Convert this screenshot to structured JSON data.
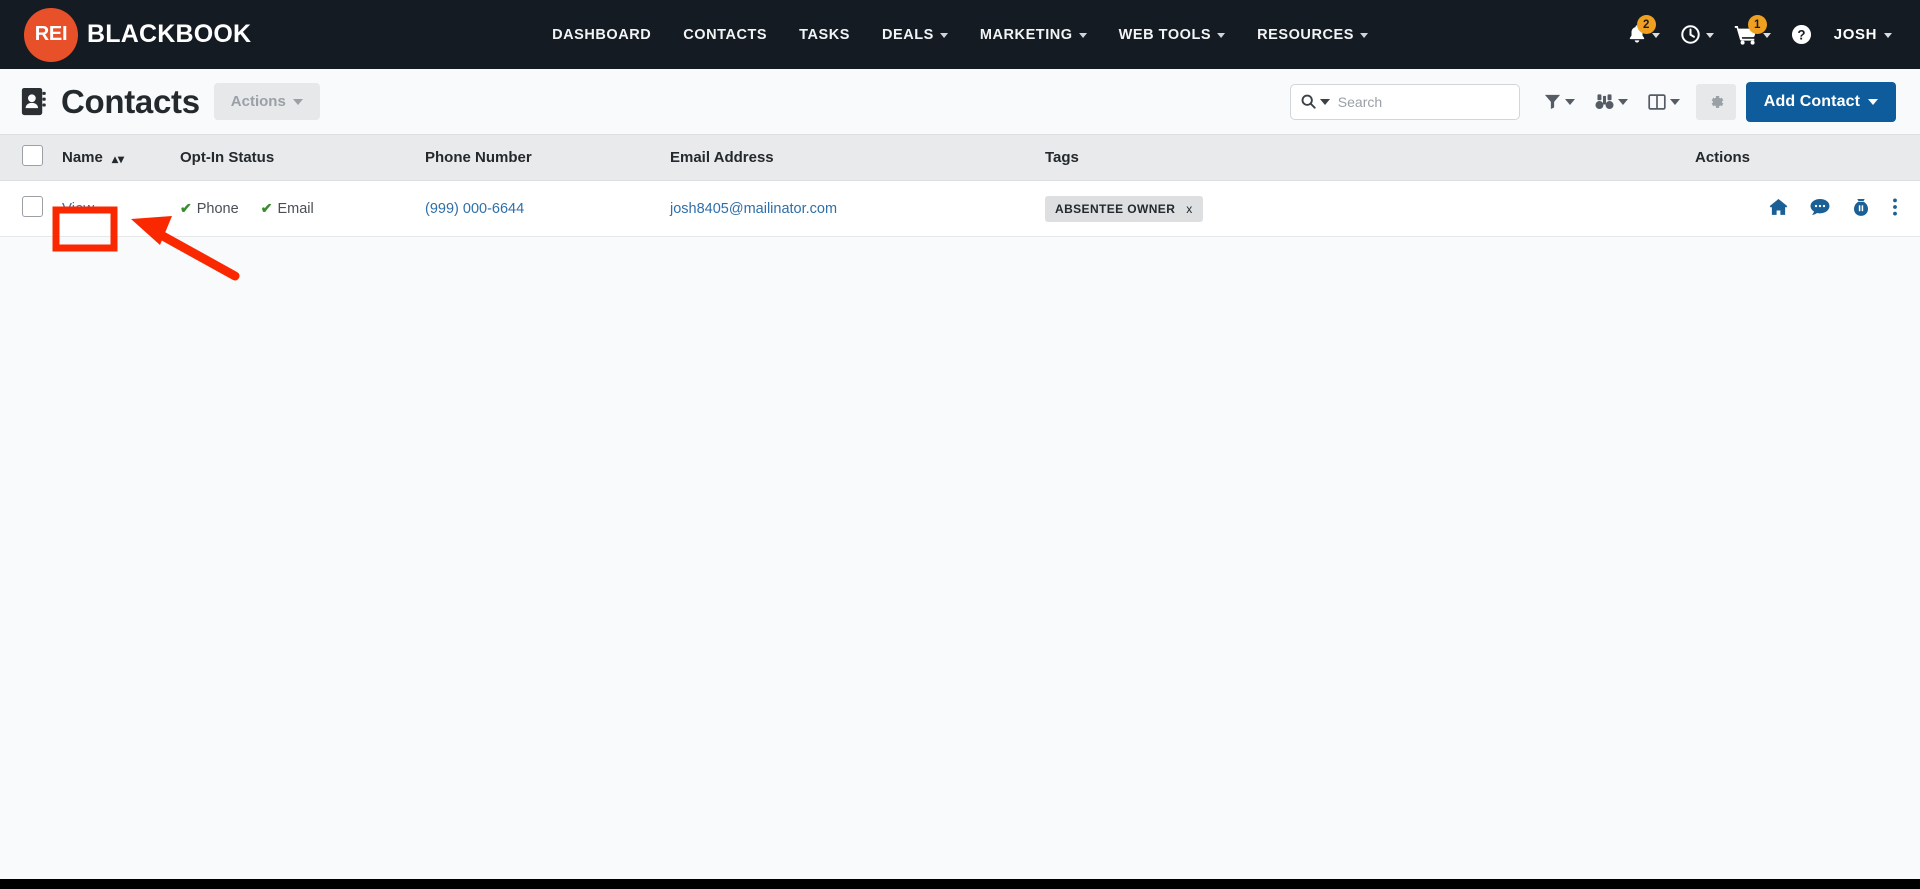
{
  "brand": {
    "badge": "REI",
    "name": "BLACKBOOK"
  },
  "topnav": {
    "items": [
      {
        "label": "DASHBOARD",
        "has_caret": false
      },
      {
        "label": "CONTACTS",
        "has_caret": false
      },
      {
        "label": "TASKS",
        "has_caret": false
      },
      {
        "label": "DEALS",
        "has_caret": true
      },
      {
        "label": "MARKETING",
        "has_caret": true
      },
      {
        "label": "WEB TOOLS",
        "has_caret": true
      },
      {
        "label": "RESOURCES",
        "has_caret": true
      }
    ],
    "notifications_badge": "2",
    "cart_badge": "1",
    "username": "JOSH"
  },
  "pagehead": {
    "title": "Contacts",
    "actions_label": "Actions",
    "add_label": "Add Contact"
  },
  "search": {
    "placeholder": "Search",
    "value": ""
  },
  "table": {
    "headers": {
      "name": "Name",
      "optin": "Opt-In Status",
      "phone": "Phone Number",
      "email": "Email Address",
      "tags": "Tags",
      "actions": "Actions"
    },
    "rows": [
      {
        "view_label": "View",
        "optin_phone": "Phone",
        "optin_email": "Email",
        "phone": "(999) 000-6644",
        "email": "josh8405@mailinator.com",
        "tag": "ABSENTEE OWNER",
        "tag_remove": "x"
      }
    ]
  },
  "colors": {
    "navbar": "#141b22",
    "brand_badge": "#e8502a",
    "primary_button": "#0f5c9c",
    "link": "#2f6fa8",
    "badge": "#f0a020",
    "annotation": "#fa2800",
    "checkmark": "#3a8d2f"
  }
}
